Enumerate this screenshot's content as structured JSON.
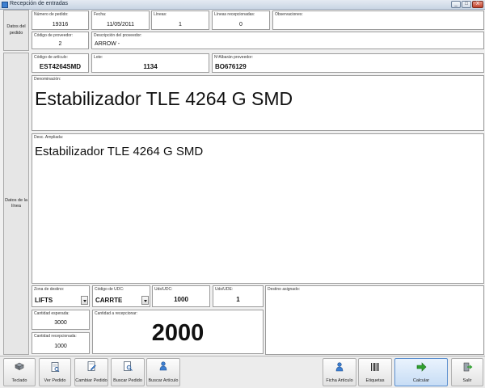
{
  "window": {
    "title": "Recepción de entradas",
    "minimize": "_",
    "maximize": "□",
    "close": "X"
  },
  "side": {
    "pedido": "Datos del pedido",
    "linea": "Datos de la línea"
  },
  "pedido": {
    "numero_label": "Número de pedido:",
    "numero": "19316",
    "fecha_label": "Fecha:",
    "fecha": "11/05/2011",
    "lineas_label": "Líneas:",
    "lineas": "1",
    "recep_label": "Líneas recepcionadas:",
    "recep": "0",
    "obs_label": "Observaciones:",
    "obs": "",
    "proveedor_label": "Código de proveedor:",
    "proveedor": "2",
    "desc_prov_label": "Descripción del proveedor:",
    "desc_prov": "ARROW -"
  },
  "linea": {
    "articulo_label": "Código de artículo:",
    "articulo": "EST4264SMD",
    "lote_label": "Lote:",
    "lote": "1134",
    "albaran_label": "NºAlbarán proveedor:",
    "albaran": "BO676129",
    "denominacion_label": "Denominación:",
    "denominacion": "Estabilizador TLE 4264 G SMD",
    "desc_ampliada_label": "Desc. Ampliada:",
    "desc_ampliada": "Estabilizador TLE 4264 G SMD",
    "zona_label": "Zona de destino:",
    "zona": "LIFTS",
    "udc_label": "Código de UDC:",
    "udc": "CARRTE",
    "uds_udc_label": "Uds/UDC:",
    "uds_udc": "1000",
    "uds_ude_label": "Uds/UDE:",
    "uds_ude": "1",
    "destino_label": "Destino asignado:",
    "destino": "",
    "esperada_label": "Cantidad esperada:",
    "esperada": "3000",
    "recepcionada_label": "Cantidad recepcionada:",
    "recepcionada": "1000",
    "a_recep_label": "Cantidad a recepcionar:",
    "a_recep": "2000"
  },
  "toolbar": {
    "teclado": "Teclado",
    "ver_pedido": "Ver Pedido",
    "cambiar_pedido": "Cambiar Pedido",
    "buscar_pedido": "Buscar Pedido",
    "buscar_articulo": "Buscar Artículo",
    "ficha_articulo": "Ficha Artículo",
    "etiquetas": "Etiquetas",
    "calcular": "Calcular",
    "salir": "Salir"
  },
  "colors": {
    "accent": "#3d7fd1",
    "calc_arrow": "#2fa12f"
  }
}
